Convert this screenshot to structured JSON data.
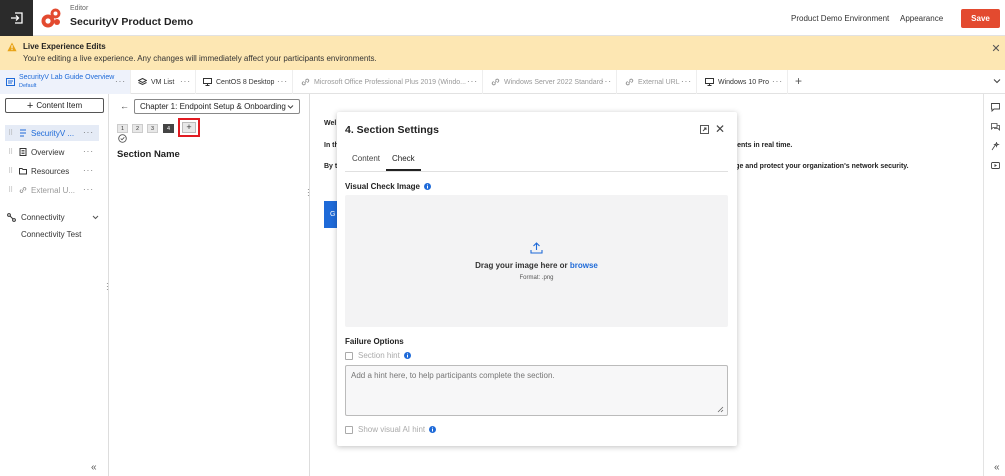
{
  "header": {
    "subtitle": "Editor",
    "title": "SecurityV Product Demo",
    "environment_link": "Product Demo Environment",
    "appearance_link": "Appearance",
    "save_label": "Save"
  },
  "banner": {
    "title": "Live Experience Edits",
    "text": "You're editing a live experience. Any changes will immediately affect your participants environments."
  },
  "tabs": [
    {
      "label": "SecurityV Lab Guide Overview",
      "sublabel": "Default",
      "icon": "guide-icon"
    },
    {
      "label": "VM List",
      "icon": "vm-list-icon"
    },
    {
      "label": "CentOS 8 Desktop",
      "icon": "desktop-icon"
    },
    {
      "label": "Microsoft Office Professional Plus 2019 (Windo...",
      "icon": "link-icon"
    },
    {
      "label": "Windows Server 2022 Standard",
      "icon": "link-icon"
    },
    {
      "label": "External URL",
      "icon": "link-icon"
    },
    {
      "label": "Windows 10 Pro",
      "icon": "desktop-icon"
    }
  ],
  "sidebar": {
    "content_item_label": "Content Item",
    "items": [
      {
        "label": "SecurityV ...",
        "icon": "guide-icon"
      },
      {
        "label": "Overview",
        "icon": "document-icon"
      },
      {
        "label": "Resources",
        "icon": "folder-icon"
      },
      {
        "label": "External U...",
        "icon": "link-icon"
      }
    ],
    "connectivity_label": "Connectivity",
    "connectivity_test_label": "Connectivity Test"
  },
  "middle": {
    "chapter_select": "Chapter 1: Endpoint Setup & Onboarding",
    "sections": [
      "1",
      "2",
      "3",
      "4"
    ],
    "add_label": "+",
    "section_name": "Section Name"
  },
  "preview": {
    "line1": "Wel",
    "line2": "In th",
    "line2_end": "cidents in real time.",
    "line3": "By t",
    "line3_end": "nage and protect your organization's network security.",
    "button_char": "G"
  },
  "modal": {
    "title": "4. Section Settings",
    "tab_content": "Content",
    "tab_check": "Check",
    "visual_check_label": "Visual Check Image",
    "drop_main": "Drag your image here or ",
    "drop_browse": "browse",
    "drop_format": "Format: .png",
    "failure_label": "Failure Options",
    "section_hint_label": "Section hint",
    "hint_placeholder": "Add a hint here, to help participants complete the section.",
    "visual_ai_label": "Show visual AI hint"
  },
  "colors": {
    "accent": "#1e6ad8",
    "save": "#e34a2f",
    "banner": "#fde7b3",
    "highlight": "#e11b22"
  }
}
